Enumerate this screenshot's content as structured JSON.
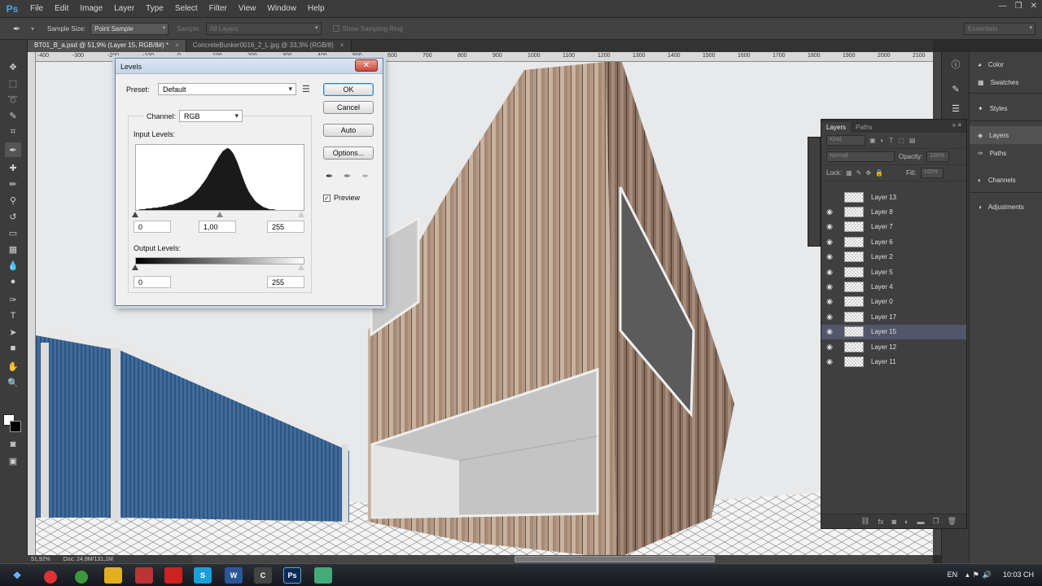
{
  "app": {
    "logo": "Ps"
  },
  "menu": [
    "File",
    "Edit",
    "Image",
    "Layer",
    "Type",
    "Select",
    "Filter",
    "View",
    "Window",
    "Help"
  ],
  "window_controls": {
    "minimize": "—",
    "restore": "❐",
    "close": "✕"
  },
  "options_bar": {
    "sample_size_label": "Sample Size:",
    "sample_size_value": "Point Sample",
    "sample_label": "Sample:",
    "sample_value": "All Layers",
    "show_ring_label": "Show Sampling Ring",
    "workspace": "Essentials"
  },
  "tabs": [
    {
      "label": "BT01_B_a.psd @ 51,9% (Layer 15, RGB/8#) *",
      "close": "×"
    },
    {
      "label": "ConcreteBunker0016_2_L.jpg @ 33,3% (RGB/8)",
      "close": "×"
    }
  ],
  "ruler_ticks": [
    "-400",
    "-300",
    "-200",
    "-100",
    "0",
    "100",
    "200",
    "300",
    "400",
    "500",
    "600",
    "700",
    "800",
    "900",
    "1000",
    "1100",
    "1200",
    "1300",
    "1400",
    "1500",
    "1600",
    "1700",
    "1800",
    "1900",
    "2000",
    "2100"
  ],
  "status": {
    "zoom": "51,92%",
    "doc": "Doc: 24,9M/131,1M"
  },
  "levels": {
    "title": "Levels",
    "close": "✕",
    "preset_label": "Preset:",
    "preset_value": "Default",
    "channel_label": "Channel:",
    "channel_value": "RGB",
    "input_levels_label": "Input Levels:",
    "input_black": "0",
    "input_gamma": "1,00",
    "input_white": "255",
    "output_levels_label": "Output Levels:",
    "output_black": "0",
    "output_white": "255",
    "buttons": {
      "ok": "OK",
      "cancel": "Cancel",
      "auto": "Auto",
      "options": "Options..."
    },
    "preview_label": "Preview",
    "preview_checked": "✓",
    "histogram": [
      0,
      0,
      1,
      1,
      1,
      2,
      2,
      2,
      3,
      3,
      3,
      4,
      4,
      5,
      5,
      6,
      7,
      7,
      8,
      9,
      10,
      11,
      12,
      14,
      15,
      17,
      19,
      21,
      24,
      27,
      30,
      34,
      38,
      42,
      47,
      52,
      57,
      62,
      67,
      72,
      76,
      80,
      82,
      84,
      83,
      80,
      76,
      70,
      63,
      55,
      47,
      39,
      32,
      26,
      21,
      17,
      13,
      10,
      8,
      6,
      4,
      3,
      2,
      1,
      1,
      1,
      0,
      0,
      0,
      0,
      0,
      0,
      0,
      0,
      0,
      0,
      0,
      0,
      0,
      0
    ]
  },
  "layers_panel": {
    "tabs": [
      "Layers",
      "Paths"
    ],
    "kind": "Kind",
    "blend": "Normal",
    "opacity_label": "Opacity:",
    "opacity_value": "100%",
    "lock_label": "Lock:",
    "fill_label": "Fill:",
    "fill_value": "100%",
    "layers": [
      {
        "name": "Layer 13",
        "visible": false
      },
      {
        "name": "Layer 8",
        "visible": true
      },
      {
        "name": "Layer 7",
        "visible": true
      },
      {
        "name": "Layer 6",
        "visible": true
      },
      {
        "name": "Layer 2",
        "visible": true
      },
      {
        "name": "Layer 5",
        "visible": true
      },
      {
        "name": "Layer 4",
        "visible": true
      },
      {
        "name": "Layer 0",
        "visible": true
      },
      {
        "name": "Layer 17",
        "visible": true
      },
      {
        "name": "Layer 15",
        "visible": true,
        "selected": true
      },
      {
        "name": "Layer 12",
        "visible": true
      },
      {
        "name": "Layer 11",
        "visible": true
      }
    ],
    "footer_icons": [
      "link-icon",
      "fx-icon",
      "mask-icon",
      "adjustment-icon",
      "folder-icon",
      "new-layer-icon",
      "trash-icon"
    ]
  },
  "side_panels": [
    "Color",
    "Swatches",
    "Styles",
    "Layers",
    "Paths",
    "Channels",
    "Adjustments"
  ],
  "taskbar": {
    "lang": "EN",
    "time": "10:03 CH"
  }
}
